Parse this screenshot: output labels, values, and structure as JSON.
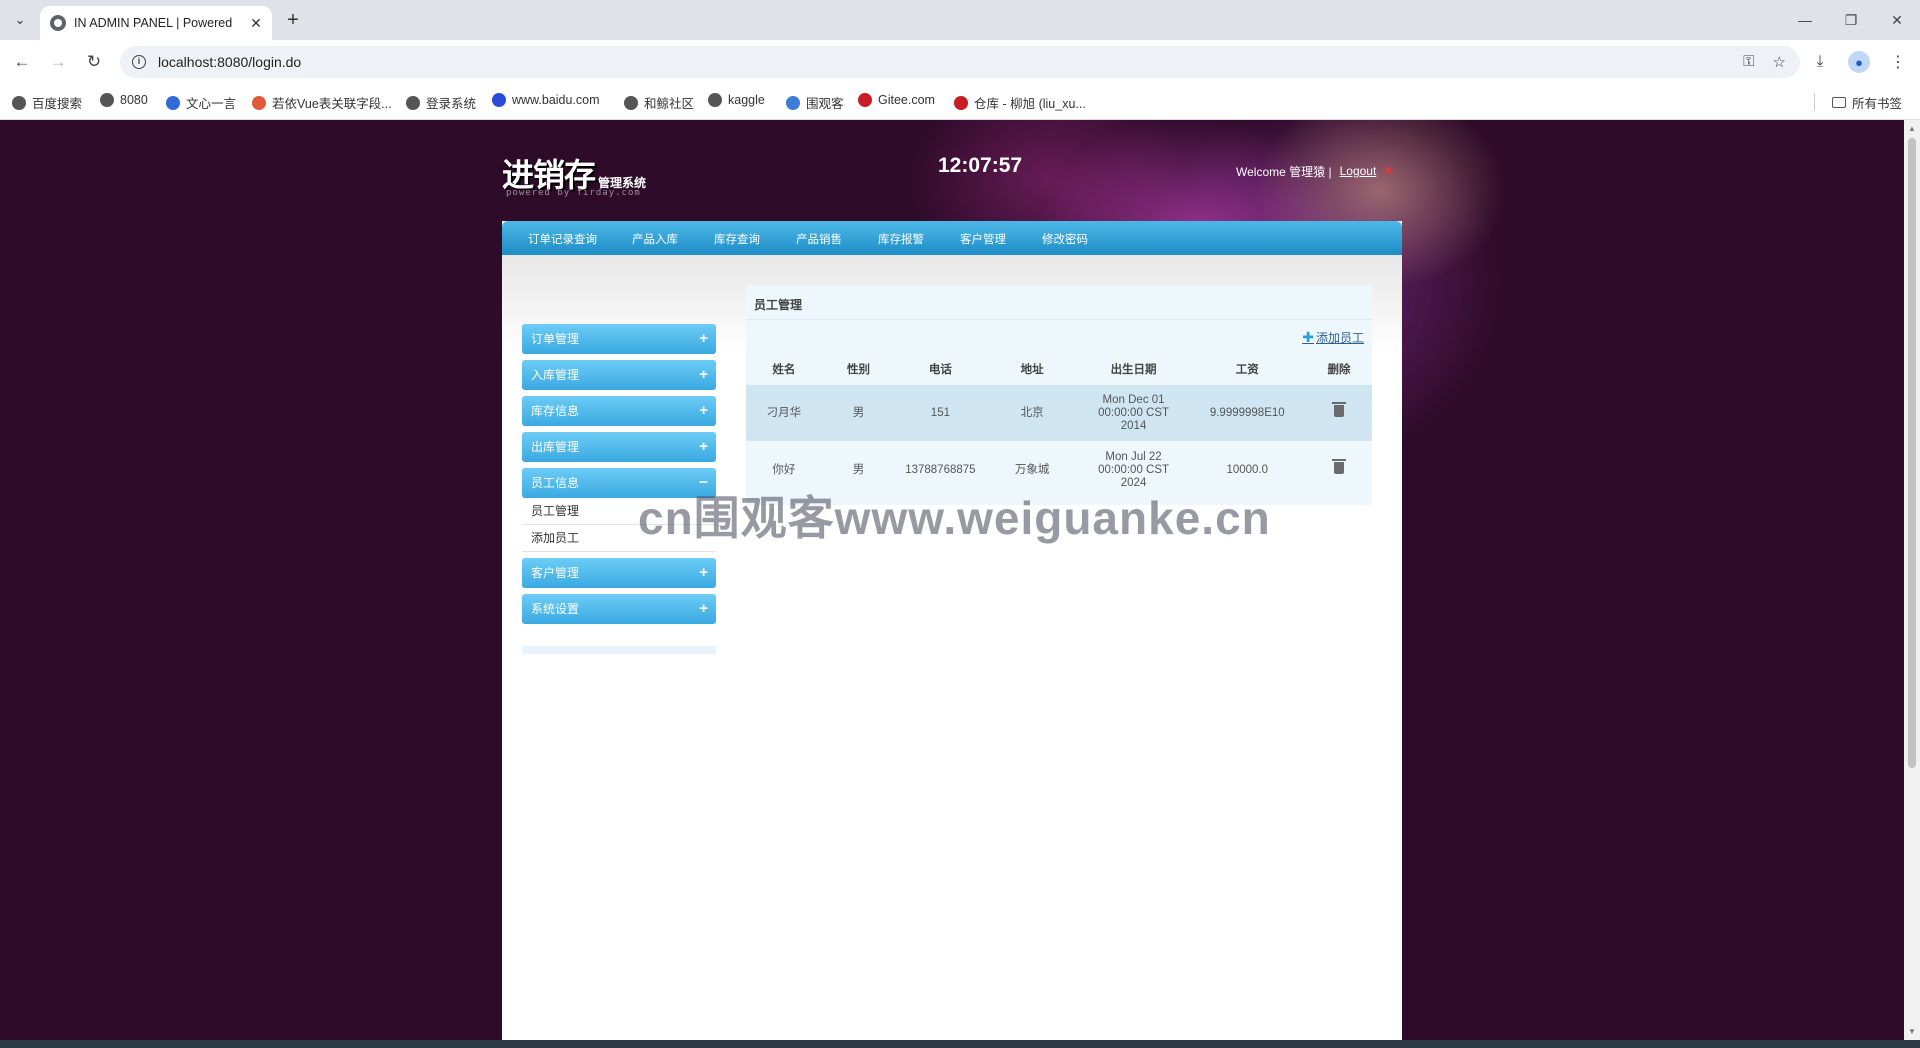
{
  "browser": {
    "tab_title": "IN ADMIN PANEL | Powered",
    "url": "localhost:8080/login.do",
    "bookmarks": [
      {
        "label": "百度搜索",
        "color": "#555555"
      },
      {
        "label": "8080",
        "color": "#555555"
      },
      {
        "label": "文心一言",
        "color": "#2f6bd8"
      },
      {
        "label": "若依Vue表关联字段...",
        "color": "#e05a3a"
      },
      {
        "label": "登录系统",
        "color": "#555555"
      },
      {
        "label": "www.baidu.com",
        "color": "#2a4bd7"
      },
      {
        "label": "和鲸社区",
        "color": "#555555"
      },
      {
        "label": "kaggle",
        "color": "#555555"
      },
      {
        "label": "围观客",
        "color": "#3b7dd8"
      },
      {
        "label": "Gitee.com",
        "color": "#c71d23"
      },
      {
        "label": "仓库 - 柳旭 (liu_xu...",
        "color": "#c71d23"
      }
    ],
    "bookmarks_folder": "所有书签"
  },
  "header": {
    "logo_main": "进销存",
    "logo_sub": "管理系统",
    "logo_powered": "powered by firday.com",
    "clock": "12:07:57",
    "welcome": "Welcome 管理猿 |",
    "logout": "Logout"
  },
  "topnav": [
    "订单记录查询",
    "产品入库",
    "库存查询",
    "产品销售",
    "库存报警",
    "客户管理",
    "修改密码"
  ],
  "sidebar": {
    "items": [
      {
        "label": "订单管理",
        "toggle": "+"
      },
      {
        "label": "入库管理",
        "toggle": "+"
      },
      {
        "label": "库存信息",
        "toggle": "+"
      },
      {
        "label": "出库管理",
        "toggle": "+"
      },
      {
        "label": "员工信息",
        "toggle": "−"
      }
    ],
    "sub_items": [
      "员工管理",
      "添加员工"
    ],
    "items_after": [
      {
        "label": "客户管理",
        "toggle": "+"
      },
      {
        "label": "系统设置",
        "toggle": "+"
      }
    ]
  },
  "panel": {
    "title": "员工管理",
    "add_link": "添加员工",
    "columns": [
      "姓名",
      "性别",
      "电话",
      "地址",
      "出生日期",
      "工资",
      "删除"
    ],
    "rows": [
      {
        "name": "刁月华",
        "gender": "男",
        "phone": "151",
        "address": "北京",
        "birth": [
          "Mon Dec 01",
          "00:00:00 CST",
          "2014"
        ],
        "salary": "9.9999998E10"
      },
      {
        "name": "你好",
        "gender": "男",
        "phone": "13788768875",
        "address": "万象城",
        "birth": [
          "Mon Jul 22",
          "00:00:00 CST",
          "2024"
        ],
        "salary": "10000.0"
      }
    ]
  },
  "watermark": "cn围观客www.weiguanke.cn"
}
